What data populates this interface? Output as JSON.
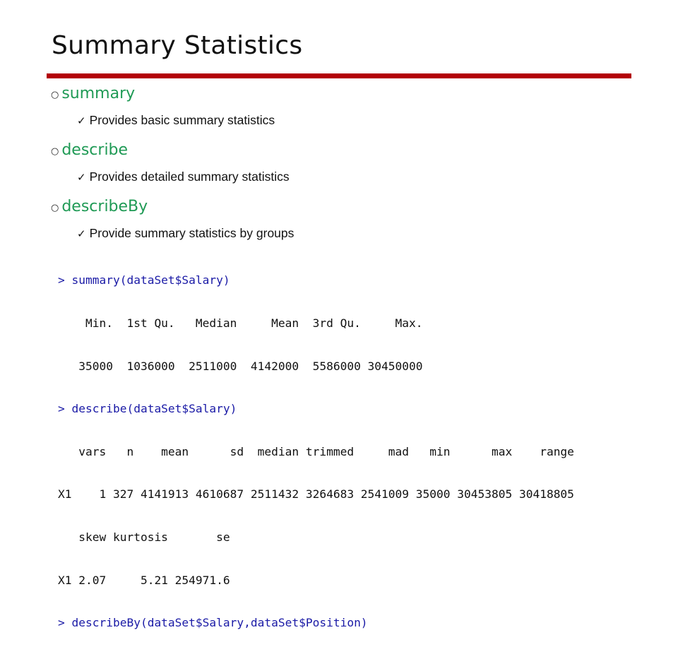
{
  "slide": {
    "title": "Summary Statistics",
    "accent_color": "#b30006",
    "term_color": "#1f9a55",
    "bullets": [
      {
        "term": "summary",
        "ring_icon": "○",
        "description": "Provides basic summary statistics",
        "check_icon": "✓"
      },
      {
        "term": "describe",
        "ring_icon": "○",
        "description": "Provides detailed summary statistics",
        "check_icon": "✓"
      },
      {
        "term": "describeBy",
        "ring_icon": "○",
        "description": "Provide summary statistics by groups",
        "check_icon": "✓"
      }
    ]
  },
  "console": {
    "lines": [
      {
        "type": "cmd",
        "text": "> summary(dataSet$Salary)"
      },
      {
        "type": "out",
        "text": "    Min.  1st Qu.   Median     Mean  3rd Qu.     Max. "
      },
      {
        "type": "out",
        "text": "   35000  1036000  2511000  4142000  5586000 30450000 "
      },
      {
        "type": "cmd",
        "text": "> describe(dataSet$Salary)"
      },
      {
        "type": "out",
        "text": "   vars   n    mean      sd  median trimmed     mad   min      max    range"
      },
      {
        "type": "out",
        "text": "X1    1 327 4141913 4610687 2511432 3264683 2541009 35000 30453805 30418805"
      },
      {
        "type": "out",
        "text": "   skew kurtosis       se"
      },
      {
        "type": "out",
        "text": "X1 2.07     5.21 254971.6"
      },
      {
        "type": "cmd",
        "text": "> describeBy(dataSet$Salary,dataSet$Position)"
      }
    ]
  }
}
